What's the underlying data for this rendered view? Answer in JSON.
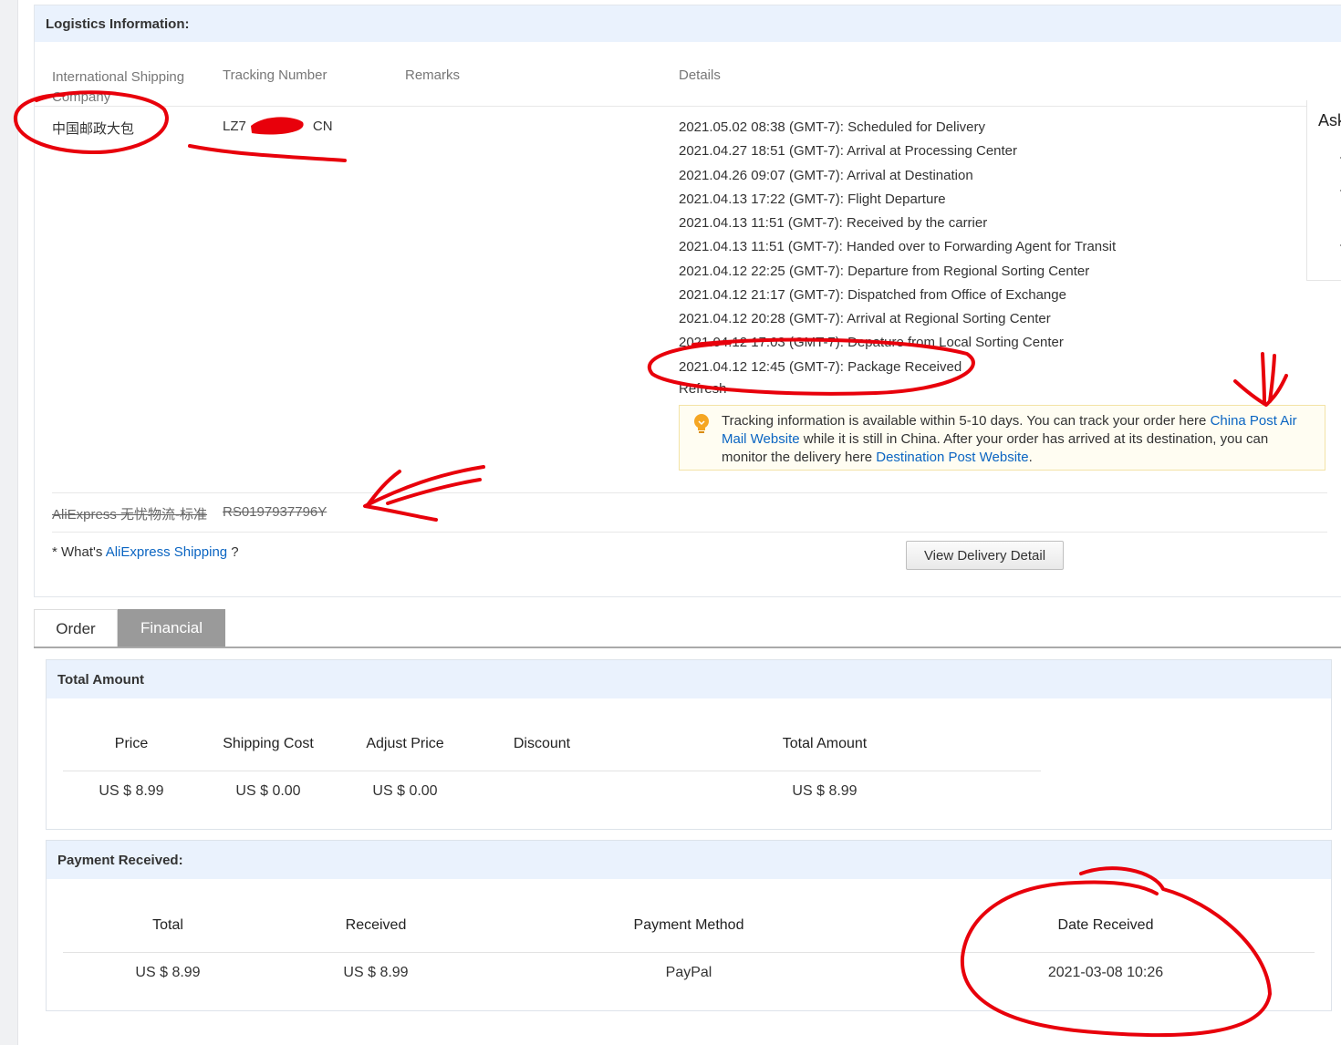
{
  "logistics": {
    "title": "Logistics Information:",
    "columns": {
      "company": "International Shipping Company",
      "tracking": "Tracking Number",
      "remarks": "Remarks",
      "details": "Details"
    },
    "carrier": "中国邮政大包",
    "tracking_number": "LZ7",
    "tracking_suffix": "CN",
    "events": [
      "2021.05.02 08:38 (GMT-7): Scheduled for Delivery",
      "2021.04.27 18:51 (GMT-7): Arrival at Processing Center",
      "2021.04.26 09:07 (GMT-7): Arrival at Destination",
      "2021.04.13 17:22 (GMT-7): Flight Departure",
      "2021.04.13 11:51 (GMT-7): Received by the carrier",
      "2021.04.13 11:51 (GMT-7): Handed over to Forwarding Agent for Transit",
      "2021.04.12 22:25 (GMT-7): Departure from Regional Sorting Center",
      "2021.04.12 21:17 (GMT-7): Dispatched from Office of Exchange",
      "2021.04.12 20:28 (GMT-7): Arrival at Regional Sorting Center",
      "2021.04.12 17:03 (GMT-7): Depature from Local Sorting Center",
      "2021.04.12 12:45 (GMT-7): Package Received"
    ],
    "refresh_label": "Refresh",
    "tip": {
      "part1": "Tracking information is available within 5-10 days. You can track your order here ",
      "link1": "China Post Air Mail Website",
      "part2": " while it is still in China. After your order has arrived at its destination, you can monitor the delivery here ",
      "link2": "Destination Post Website",
      "part3": "."
    },
    "old_shipment": {
      "company": "AliExpress 无忧物流-标准",
      "tracking": "RS0197937796Y"
    },
    "whats_prefix": "* What's ",
    "whats_link": "AliExpress Shipping",
    "whats_suffix": " ?",
    "view_button": "View Delivery Detail"
  },
  "side_panel": {
    "label": "Ask"
  },
  "tabs": [
    {
      "label": "Order",
      "active": false
    },
    {
      "label": "Financial",
      "active": true
    }
  ],
  "total_amount": {
    "title": "Total Amount",
    "headers": [
      "Price",
      "Shipping Cost",
      "Adjust Price",
      "Discount",
      "Total Amount"
    ],
    "values": [
      "US $ 8.99",
      "US $ 0.00",
      "US $ 0.00",
      "",
      "US $ 8.99"
    ]
  },
  "payment": {
    "title": "Payment Received:",
    "headers": [
      "Total",
      "Received",
      "Payment Method",
      "Date Received"
    ],
    "values": [
      "US $ 8.99",
      "US $ 8.99",
      "PayPal",
      "2021-03-08 10:26"
    ]
  },
  "colors": {
    "panel_head": "#eaf2fd",
    "link": "#0b65c2",
    "annotation": "#e8000b",
    "tab_active": "#9a9a9a"
  }
}
